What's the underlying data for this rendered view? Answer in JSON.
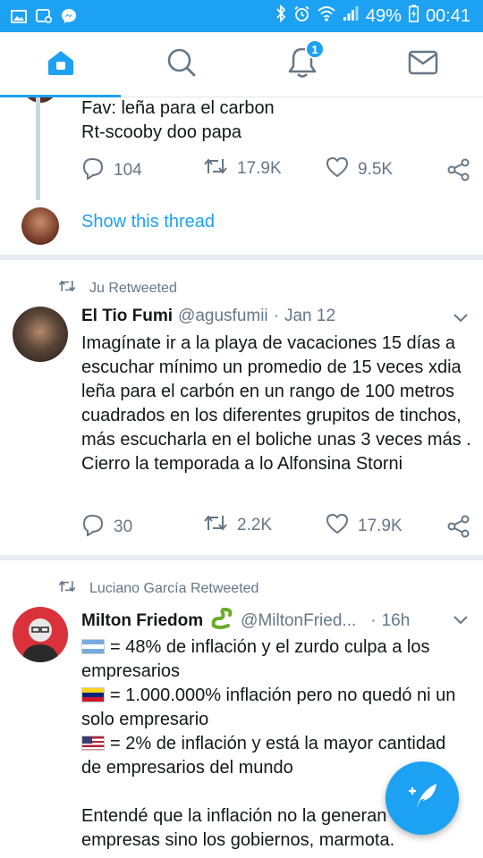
{
  "status_bar": {
    "battery": "49%",
    "time": "00:41"
  },
  "nav": {
    "notification_count": "1"
  },
  "tweet1": {
    "line1": "Fav: leña para el carbon",
    "line2": "Rt-scooby doo papa",
    "replies": "104",
    "retweets": "17.9K",
    "likes": "9.5K",
    "show_thread": "Show this thread"
  },
  "tweet2": {
    "retweeted_by": "Ju Retweeted",
    "name": "El Tio Fumi",
    "handle": "@agusfumii",
    "dot": "·",
    "date": "Jan 12",
    "text": "Imagínate ir a la playa de vacaciones 15 días a escuchar mínimo un promedio de 15 veces xdia leña para el carbón en un rango de 100 metros cuadrados en los diferentes grupitos de tinchos, más escucharla en el boliche unas 3 veces más . Cierro la temporada a lo Alfonsina Storni",
    "replies": "30",
    "retweets": "2.2K",
    "likes": "17.9K"
  },
  "tweet3": {
    "retweeted_by": "Luciano García Retweeted",
    "name": "Milton Friedom",
    "handle": "@MiltonFried...",
    "dot": "·",
    "date": "16h",
    "line1": "= 48% de inflación y el zurdo culpa a los",
    "line2": "empresarios",
    "line3": "= 1.000.000% inflación pero no quedó ni un",
    "line4": "solo empresario",
    "line5": "= 2% de inflación y está la mayor cantidad",
    "line6": "de empresarios del mundo",
    "line7": "Entendé que la inflación no la generan",
    "line8": "empresas sino los gobiernos, marmota."
  },
  "colors": {
    "accent": "#1da1f2",
    "muted": "#657786",
    "divider": "#e6ecf0"
  }
}
